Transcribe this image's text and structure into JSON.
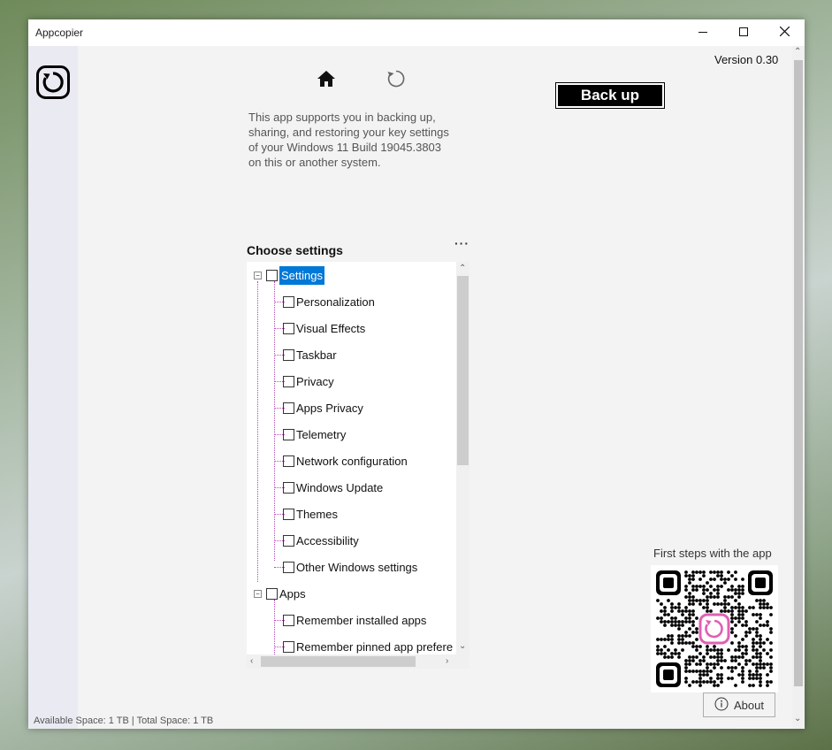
{
  "window": {
    "title": "Appcopier"
  },
  "titlebar": {
    "minimize_icon": "minimize-icon",
    "maximize_icon": "maximize-icon",
    "close_icon": "close-icon"
  },
  "header": {
    "version": "Version 0.30",
    "home_icon": "home-icon",
    "refresh_icon": "refresh-icon",
    "description": "This app supports you in backing up,\nsharing, and restoring your key settings\nof your Windows 11 Build 19045.3803\non this or another system.",
    "backup_label": "Back up"
  },
  "settings": {
    "heading": "Choose settings",
    "more_label": "···",
    "tree": [
      {
        "label": "Settings",
        "level": 0,
        "selected": true
      },
      {
        "label": "Personalization",
        "level": 1
      },
      {
        "label": "Visual Effects",
        "level": 1
      },
      {
        "label": "Taskbar",
        "level": 1
      },
      {
        "label": "Privacy",
        "level": 1
      },
      {
        "label": "Apps Privacy",
        "level": 1
      },
      {
        "label": "Telemetry",
        "level": 1
      },
      {
        "label": "Network configuration",
        "level": 1
      },
      {
        "label": "Windows Update",
        "level": 1
      },
      {
        "label": "Themes",
        "level": 1
      },
      {
        "label": "Accessibility",
        "level": 1
      },
      {
        "label": "Other Windows settings",
        "level": 1
      },
      {
        "label": "Apps",
        "level": 0
      },
      {
        "label": "Remember installed apps",
        "level": 1
      },
      {
        "label": "Remember pinned app prefere",
        "level": 1
      }
    ]
  },
  "help": {
    "qr_label": "First steps with the app",
    "about_label": "About",
    "info_icon": "info-icon"
  },
  "status": {
    "text": "Available Space: 1 TB | Total Space: 1 TB"
  },
  "colors": {
    "accent": "#0078d7",
    "backup_bg": "#000000",
    "qr_logo": "#e05fb5"
  }
}
